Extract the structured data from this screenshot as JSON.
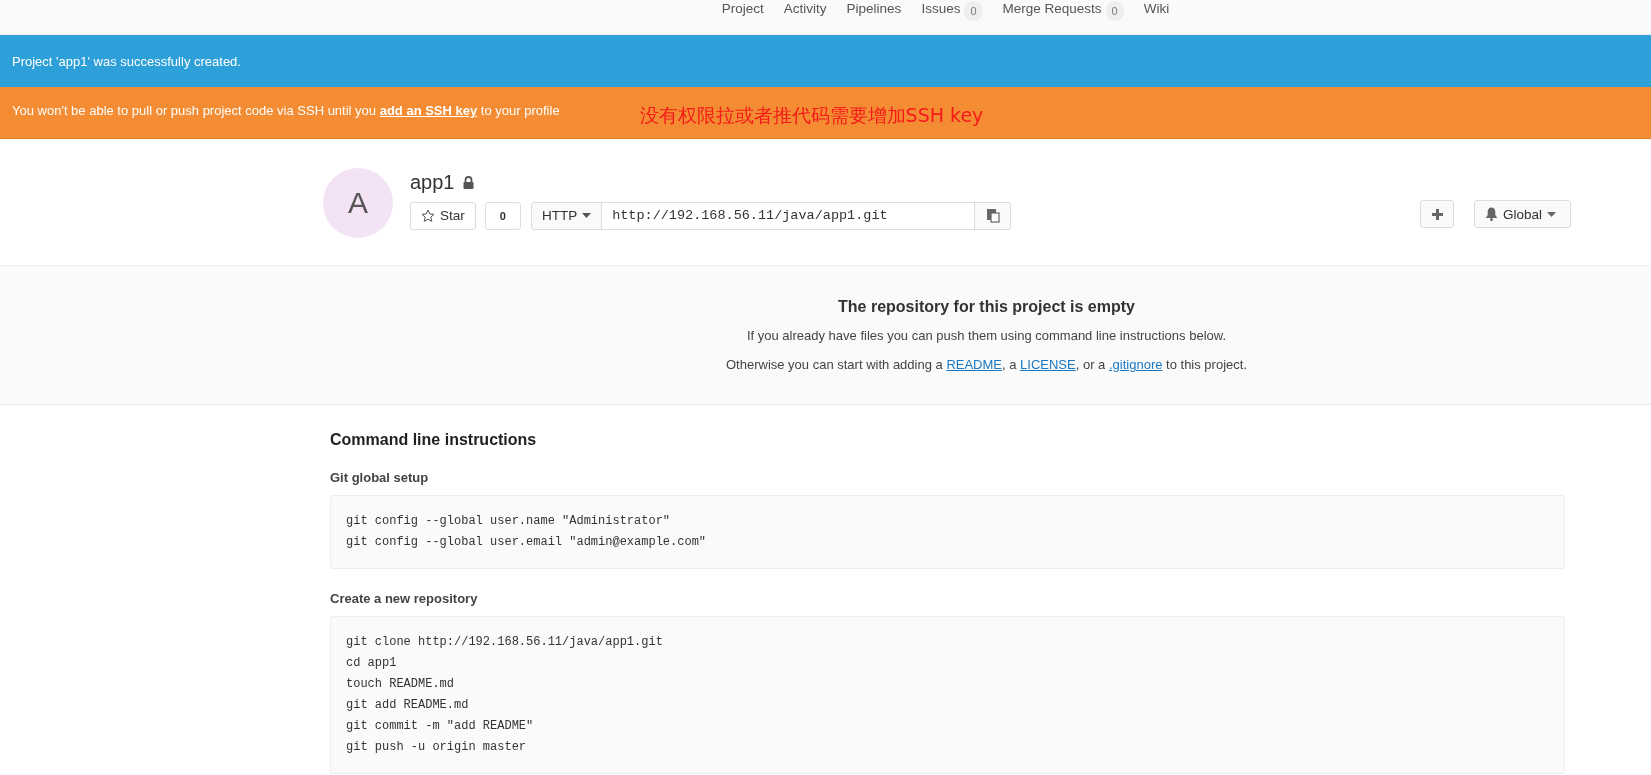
{
  "nav": {
    "items": [
      {
        "label": "Project"
      },
      {
        "label": "Activity"
      },
      {
        "label": "Pipelines"
      },
      {
        "label": "Issues",
        "count": "0"
      },
      {
        "label": "Merge Requests",
        "count": "0"
      },
      {
        "label": "Wiki"
      }
    ]
  },
  "flash": {
    "notice": "Project 'app1' was successfully created.",
    "alert": [
      {
        "kind": "text",
        "text": "You won't be able to pull or push project code via SSH until you "
      },
      {
        "kind": "link",
        "text": "add an SSH key"
      },
      {
        "kind": "text",
        "text": " to your profile"
      }
    ],
    "annotation": "没有权限拉或者推代码需要增加SSH key"
  },
  "project": {
    "avatar_letter": "A",
    "name": "app1",
    "private": true,
    "star_label": "Star",
    "star_count": "0",
    "protocol": "HTTP",
    "clone_url": "http://192.168.56.11/java/app1.git",
    "notification_level": "Global"
  },
  "empty_repo": {
    "title": "The repository for this project is empty",
    "lines": [
      [
        {
          "kind": "text",
          "text": "If you already have files you can push them using command line instructions below."
        }
      ],
      [
        {
          "kind": "text",
          "text": "Otherwise you can start with adding a "
        },
        {
          "kind": "link",
          "text": "README"
        },
        {
          "kind": "text",
          "text": ", a "
        },
        {
          "kind": "link",
          "text": "LICENSE"
        },
        {
          "kind": "text",
          "text": ", or a "
        },
        {
          "kind": "link",
          "text": ".gitignore"
        },
        {
          "kind": "text",
          "text": " to this project."
        }
      ]
    ]
  },
  "instructions": {
    "title": "Command line instructions",
    "sections": [
      {
        "title": "Git global setup",
        "lines": [
          "git config --global user.name \"Administrator\"",
          "git config --global user.email \"admin@example.com\""
        ]
      },
      {
        "title": "Create a new repository",
        "lines": [
          "git clone http://192.168.56.11/java/app1.git",
          "cd app1",
          "touch README.md",
          "git add README.md",
          "git commit -m \"add README\"",
          "git push -u origin master"
        ]
      }
    ]
  }
}
